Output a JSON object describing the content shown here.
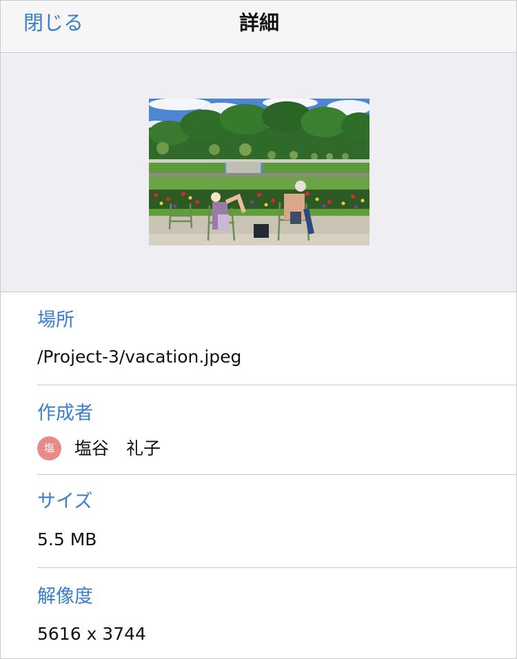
{
  "navbar": {
    "close_label": "閉じる",
    "title": "詳細"
  },
  "preview": {
    "alt": "vacation.jpeg"
  },
  "details": {
    "location": {
      "label": "場所",
      "value": "/Project-3/vacation.jpeg"
    },
    "author": {
      "label": "作成者",
      "avatar_initial": "塩",
      "name": "塩谷　礼子",
      "avatar_color": "#e88a8a"
    },
    "size": {
      "label": "サイズ",
      "value": "5.5 MB"
    },
    "resolution": {
      "label": "解像度",
      "value": "5616 x 3744"
    }
  },
  "colors": {
    "accent": "#3a7ecb",
    "navbar_bg": "#f6f6f7",
    "preview_bg": "#efeff3",
    "separator": "#c8c8cc"
  }
}
